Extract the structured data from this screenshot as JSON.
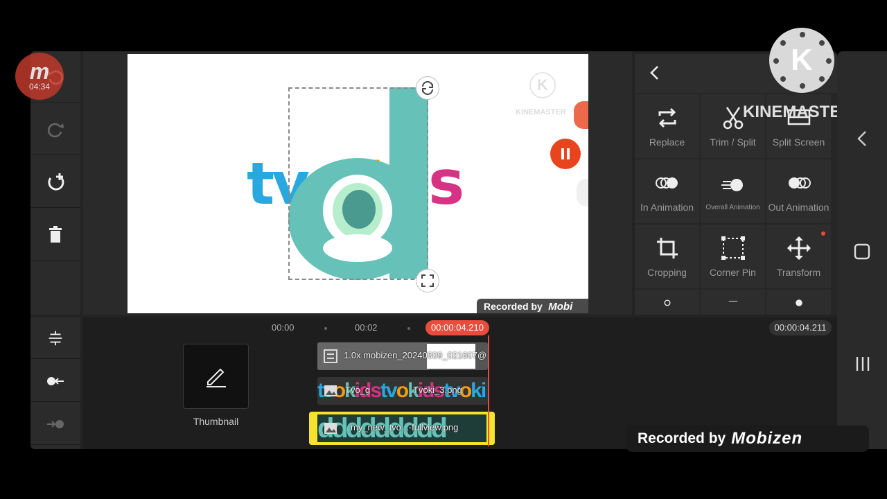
{
  "mobizen": {
    "logo": "m",
    "time": "04:34"
  },
  "kinemaster": {
    "logo": "K",
    "wordmark": "KINEMASTER"
  },
  "preview": {
    "left_letters": "tv",
    "middle_letters": "oki",
    "right_letter": "s",
    "big_letter": "d",
    "watermark": "KINEMASTER",
    "recorded_by": "Recorded by",
    "recorded_brand": "Mobi"
  },
  "left_toolbar": {
    "icons": [
      "undo-icon",
      "redo-icon",
      "add-rotate-icon",
      "delete-icon"
    ],
    "bottom_icons": [
      "split-timeline-icon",
      "record-left-icon",
      "record-right-icon"
    ]
  },
  "panel": {
    "back": "<",
    "options": [
      {
        "label": "Replace"
      },
      {
        "label": "Trim / Split"
      },
      {
        "label": "Split Screen"
      },
      {
        "label": "In Animation"
      },
      {
        "label": "Overall Animation"
      },
      {
        "label": "Out Animation"
      },
      {
        "label": "Cropping"
      },
      {
        "label": "Corner Pin"
      },
      {
        "label": "Transform"
      }
    ]
  },
  "timeline": {
    "tc_start": "00:00",
    "tc_mid": "00:02",
    "playhead": "00:00:04.210",
    "total": "00:00:04.211",
    "thumbnail_label": "Thumbnail",
    "clips": [
      {
        "label": "1.0x mobizen_20240809_021607@"
      },
      {
        "label": "Tvoki_3.png",
        "label_prefix": "Tvo_g"
      },
      {
        "label": "my_new_tvo...-fullview.png"
      }
    ]
  },
  "recorded_badge": {
    "text": "Recorded by",
    "brand": "Mobizen"
  },
  "colors": {
    "accent_red": "#e74c3c",
    "teal": "#66c2b8",
    "selection_yellow": "#f5e42b",
    "panel_bg": "#2d2d2d"
  }
}
